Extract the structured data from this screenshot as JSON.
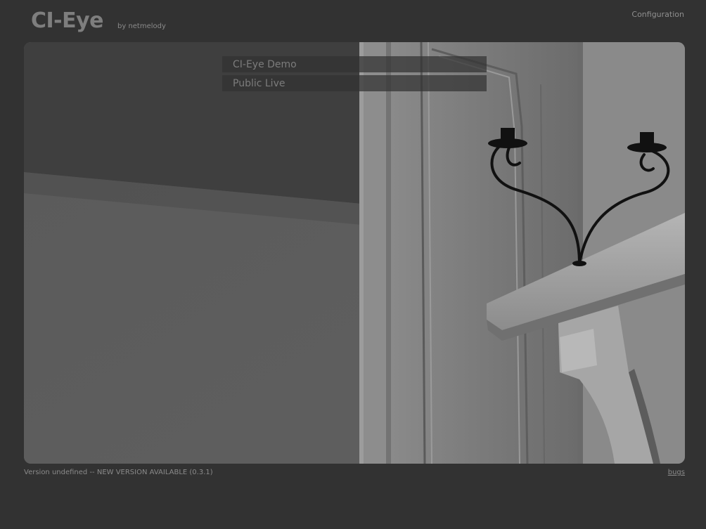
{
  "header": {
    "logo": "CI-Eye",
    "byline": "by netmelody",
    "config_link": "Configuration"
  },
  "menu": {
    "items": [
      {
        "label": "CI-Eye Demo"
      },
      {
        "label": "Public Live"
      }
    ]
  },
  "footer": {
    "version_text": "Version undefined -- NEW VERSION AVAILABLE (0.3.1)",
    "bugs_link": "bugs"
  },
  "colors": {
    "background": "#323232",
    "logo": "#7e7e7e",
    "menu_text": "#7c7c7c"
  }
}
